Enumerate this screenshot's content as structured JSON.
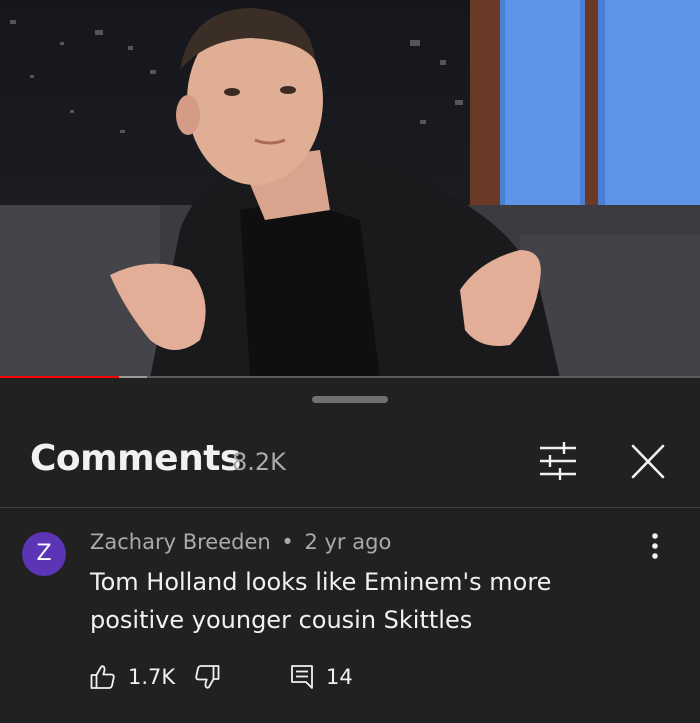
{
  "video": {
    "played_fraction": 0.17,
    "buffered_fraction": 0.21,
    "accent_color": "#ff0000"
  },
  "comments": {
    "title": "Comments",
    "count": "8.2K",
    "sort_icon": "sliders-icon",
    "close_icon": "close-icon"
  },
  "comment": {
    "avatar_letter": "Z",
    "avatar_color": "#5b35b5",
    "author": "Zachary Breeden",
    "separator": "•",
    "time": "2 yr ago",
    "text": "Tom Holland looks like Eminem's more positive younger cousin Skittles",
    "likes": "1.7K",
    "replies": "14",
    "like_icon": "thumbs-up-icon",
    "dislike_icon": "thumbs-down-icon",
    "reply_icon": "reply-icon",
    "more_icon": "more-vert-icon"
  }
}
